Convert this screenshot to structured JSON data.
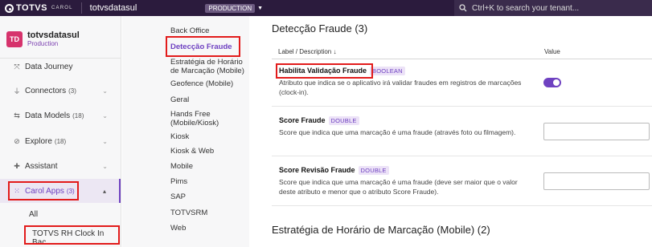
{
  "topbar": {
    "logo_text": "TOTVS",
    "logo_sub": "CAROL",
    "tenant": "totvsdatasul",
    "environment": "PRODUCTION",
    "search_placeholder": "Ctrl+K to search your tenant..."
  },
  "app": {
    "icon_text": "TD",
    "name": "totvsdatasul",
    "env": "Production",
    "icon_color": "#d6336c"
  },
  "sidebar": {
    "items": [
      {
        "label": "Data Journey",
        "count": "",
        "icon": "journey-icon"
      },
      {
        "label": "Connectors",
        "count": "(3)",
        "icon": "plug-icon"
      },
      {
        "label": "Data Models",
        "count": "(18)",
        "icon": "data-models-icon"
      },
      {
        "label": "Explore",
        "count": "(18)",
        "icon": "compass-icon"
      },
      {
        "label": "Assistant",
        "count": "",
        "icon": "assistant-icon"
      },
      {
        "label": "Carol Apps",
        "count": "(3)",
        "icon": "apps-grid-icon"
      }
    ],
    "sub_items": [
      "All",
      "TOTVS RH Clock In Bac..."
    ]
  },
  "settings_nav": [
    "Back Office",
    "Detecção Fraude",
    "Estratégia de Horário de Marcação (Mobile)",
    "Geofence (Mobile)",
    "Geral",
    "Hands Free (Mobile/Kiosk)",
    "Kiosk",
    "Kiosk & Web",
    "Mobile",
    "Pims",
    "SAP",
    "TOTVSRM",
    "Web"
  ],
  "section": {
    "title": "Detecção Fraude (3)",
    "col_label": "Label / Description",
    "col_sort": "↓",
    "col_value": "Value",
    "rows": [
      {
        "label": "Habilita Validação Fraude",
        "type": "BOOLEAN",
        "description": "Atributo que indica se o aplicativo irá validar fraudes em registros de marcações (clock-in).",
        "value": true
      },
      {
        "label": "Score Fraude",
        "type": "DOUBLE",
        "description": "Score que indica que uma marcação é uma fraude (através foto ou filmagem).",
        "value": ""
      },
      {
        "label": "Score Revisão Fraude",
        "type": "DOUBLE",
        "description": "Score que indica que uma marcação é uma fraude (deve ser maior que o valor deste atributo e menor que o atributo Score Fraude).",
        "value": ""
      }
    ]
  },
  "next_section_title": "Estratégia de Horário de Marcação (Mobile) (2)",
  "colors": {
    "accent": "#6f42c1",
    "topbar": "#2b1b3d",
    "highlight": "#e21b1b"
  }
}
